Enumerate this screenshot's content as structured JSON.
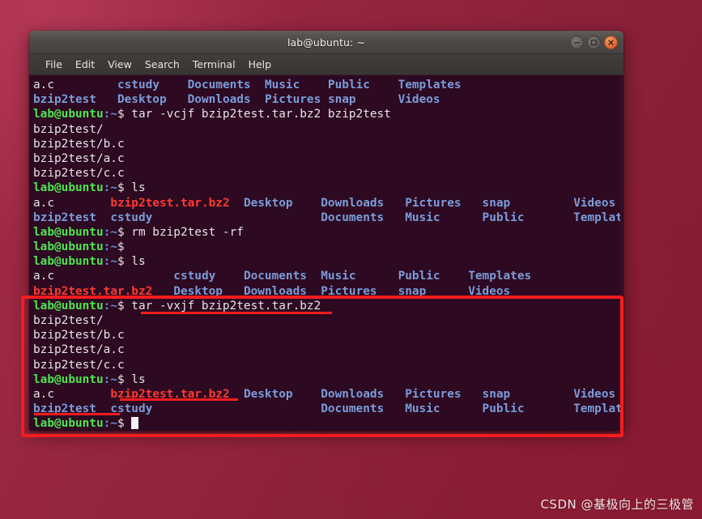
{
  "window": {
    "title": "lab@ubuntu: ~",
    "buttons": {
      "minimize": "minimize",
      "maximize": "maximize",
      "close": "close"
    }
  },
  "menu": {
    "items": [
      "File",
      "Edit",
      "View",
      "Search",
      "Terminal",
      "Help"
    ]
  },
  "prompt": {
    "user_host": "lab@ubuntu",
    "path": ":~",
    "symbol": "$"
  },
  "terminal": {
    "lines": [
      {
        "id": "l01",
        "type": "ls",
        "cols": [
          "a.c",
          "cstudy",
          "Documents",
          "Music",
          "Public",
          "Templates"
        ]
      },
      {
        "id": "l02",
        "type": "ls",
        "cols": [
          "bzip2test",
          "Desktop",
          "Downloads",
          "Pictures",
          "snap",
          "Videos"
        ]
      },
      {
        "id": "l03",
        "type": "prompt",
        "command": "tar -vcjf bzip2test.tar.bz2 bzip2test"
      },
      {
        "id": "l04",
        "type": "out",
        "text": "bzip2test/"
      },
      {
        "id": "l05",
        "type": "out",
        "text": "bzip2test/b.c"
      },
      {
        "id": "l06",
        "type": "out",
        "text": "bzip2test/a.c"
      },
      {
        "id": "l07",
        "type": "out",
        "text": "bzip2test/c.c"
      },
      {
        "id": "l08",
        "type": "prompt",
        "command": "ls"
      },
      {
        "id": "l09",
        "type": "ls2",
        "cols": [
          "a.c",
          "bzip2test.tar.bz2",
          "Desktop",
          "Downloads",
          "Pictures",
          "snap",
          "Videos"
        ]
      },
      {
        "id": "l10",
        "type": "ls2",
        "cols": [
          "bzip2test",
          "cstudy",
          "",
          "Documents",
          "Music",
          "Public",
          "Templates"
        ]
      },
      {
        "id": "l11",
        "type": "prompt",
        "command": "rm bzip2test -rf"
      },
      {
        "id": "l12",
        "type": "prompt",
        "command": ""
      },
      {
        "id": "l13",
        "type": "prompt",
        "command": "ls"
      },
      {
        "id": "l14",
        "type": "ls3",
        "cols": [
          "a.c",
          "cstudy",
          "Documents",
          "Music",
          "Public",
          "Templates"
        ]
      },
      {
        "id": "l15",
        "type": "ls3",
        "cols": [
          "bzip2test.tar.bz2",
          "Desktop",
          "Downloads",
          "Pictures",
          "snap",
          "Videos"
        ]
      },
      {
        "id": "l16",
        "type": "prompt",
        "command": "tar -vxjf bzip2test.tar.bz2"
      },
      {
        "id": "l17",
        "type": "out",
        "text": "bzip2test/"
      },
      {
        "id": "l18",
        "type": "out",
        "text": "bzip2test/b.c"
      },
      {
        "id": "l19",
        "type": "out",
        "text": "bzip2test/a.c"
      },
      {
        "id": "l20",
        "type": "out",
        "text": "bzip2test/c.c"
      },
      {
        "id": "l21",
        "type": "prompt",
        "command": "ls"
      },
      {
        "id": "l22",
        "type": "ls2",
        "cols": [
          "a.c",
          "bzip2test.tar.bz2",
          "Desktop",
          "Downloads",
          "Pictures",
          "snap",
          "Videos"
        ]
      },
      {
        "id": "l23",
        "type": "ls2",
        "cols": [
          "bzip2test",
          "cstudy",
          "",
          "Documents",
          "Music",
          "Public",
          "Templates"
        ]
      },
      {
        "id": "l24",
        "type": "cursor",
        "command": ""
      }
    ],
    "archive_file": "bzip2test.tar.bz2",
    "directory_file": "bzip2test"
  },
  "annotations": {
    "highlight_box_label": "extract-command-highlight",
    "underline_command": "tar -vxjf bzip2test.tar.bz2",
    "underline_archive": "bzip2test.tar.bz2",
    "underline_directory": "bzip2test"
  },
  "colors": {
    "prompt_green": "#4ee44e",
    "dir_blue": "#7b9cd8",
    "archive_red": "#ff3a30",
    "text_white": "#e6e6e6",
    "terminal_bg": "#2d0922",
    "annotation_red": "#f51d1d",
    "desktop": "#98263f"
  },
  "watermark": {
    "text": "CSDN @基极向上的三极管"
  }
}
